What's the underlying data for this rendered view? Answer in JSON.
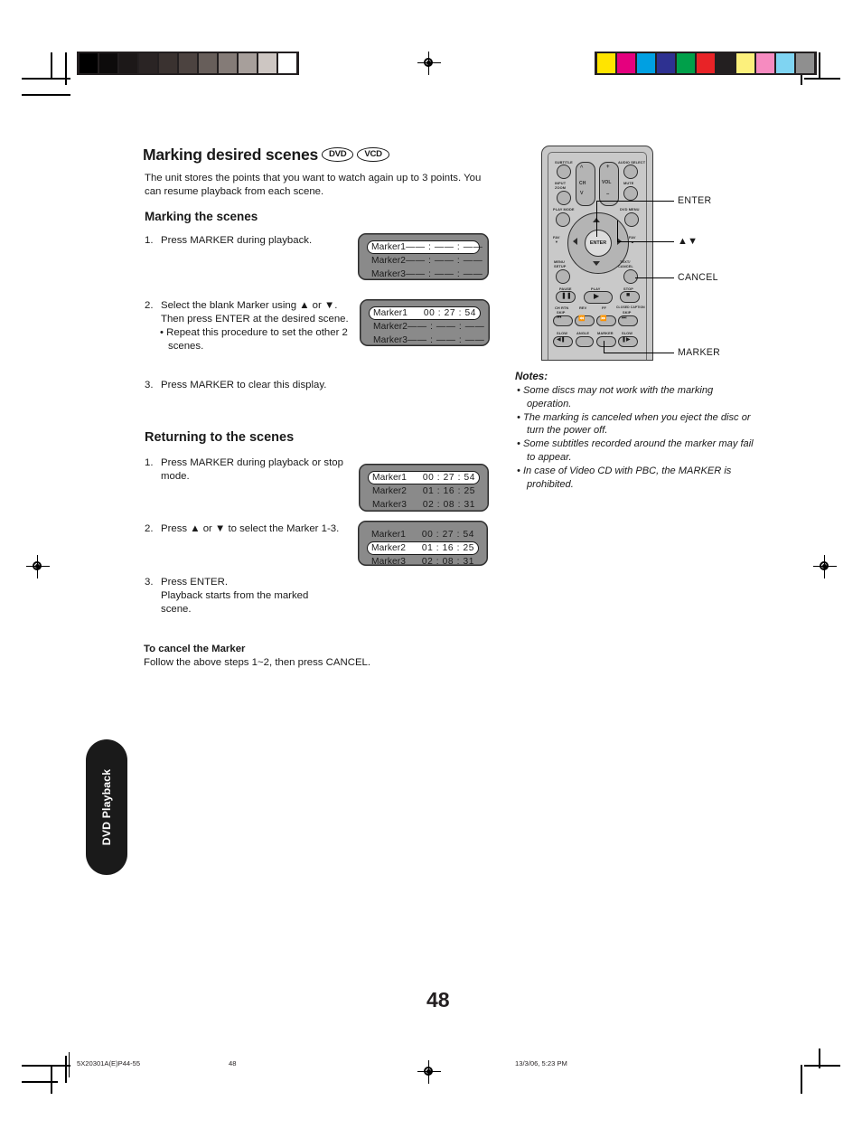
{
  "document": {
    "section_title": "Marking desired scenes",
    "media_badges": [
      "DVD",
      "VCD"
    ],
    "intro": "The unit stores the points that you want to watch again up to 3 points. You can resume playback from each scene.",
    "page_number": "48"
  },
  "marking": {
    "heading": "Marking the scenes",
    "steps": [
      {
        "num": "1.",
        "text": "Press MARKER during playback."
      },
      {
        "num": "2.",
        "text": "Select the blank Marker using ▲ or ▼. Then press ENTER at the desired scene.",
        "sub": "• Repeat this procedure to set the other 2 scenes."
      },
      {
        "num": "3.",
        "text": "Press MARKER to clear this display."
      }
    ]
  },
  "returning": {
    "heading": "Returning to the scenes",
    "steps": [
      {
        "num": "1.",
        "text": "Press MARKER during playback or stop mode."
      },
      {
        "num": "2.",
        "text": "Press ▲ or ▼ to select the Marker 1-3."
      },
      {
        "num": "3.",
        "text": "Press ENTER.",
        "extra": "Playback starts from the marked scene."
      }
    ]
  },
  "cancel": {
    "heading": "To cancel the Marker",
    "text": "Follow the above steps 1~2, then press CANCEL."
  },
  "osd_panels": [
    {
      "id": "osd-marking-step1",
      "rows": [
        {
          "label": "Marker1",
          "time": "—— : —— : ——",
          "selected": true
        },
        {
          "label": "Marker2",
          "time": "—— : —— : ——",
          "selected": false
        },
        {
          "label": "Marker3",
          "time": "—— : —— : ——",
          "selected": false
        }
      ]
    },
    {
      "id": "osd-marking-step2",
      "rows": [
        {
          "label": "Marker1",
          "time": "00 : 27 : 54",
          "selected": true
        },
        {
          "label": "Marker2",
          "time": "—— : —— : ——",
          "selected": false
        },
        {
          "label": "Marker3",
          "time": "—— : —— : ——",
          "selected": false
        }
      ]
    },
    {
      "id": "osd-returning-step1",
      "rows": [
        {
          "label": "Marker1",
          "time": "00 : 27 : 54",
          "selected": true
        },
        {
          "label": "Marker2",
          "time": "01 : 16 : 25",
          "selected": false
        },
        {
          "label": "Marker3",
          "time": "02 : 08 : 31",
          "selected": false
        }
      ]
    },
    {
      "id": "osd-returning-step2",
      "rows": [
        {
          "label": "Marker1",
          "time": "00 : 27 : 54",
          "selected": false
        },
        {
          "label": "Marker2",
          "time": "01 : 16 : 25",
          "selected": true
        },
        {
          "label": "Marker3",
          "time": "02 : 08 : 31",
          "selected": false
        }
      ]
    }
  ],
  "remote": {
    "buttons": [
      "SUBTITLE",
      "AUDIO SELECT",
      "INPUT ZOOM",
      "CH",
      "VOL",
      "MUTE",
      "PLAY MODE",
      "DVD MENU",
      "ENTER",
      "FAV ▼",
      "FAV ▲",
      "MENU SETUP",
      "TEXT/ CANCEL",
      "PAUSE",
      "PLAY",
      "STOP",
      "CH RTN SKIP",
      "REV",
      "FF",
      "CLOSED CAPTION SKIP",
      "SLOW",
      "ANGLE",
      "MARKER",
      "SLOW"
    ],
    "labels": {
      "subtitle": "SUBTITLE",
      "audio_select": "AUDIO SELECT",
      "input_zoom_1": "INPUT",
      "input_zoom_2": "ZOOM",
      "ch": "CH",
      "vol": "VOL",
      "mute": "MUTE",
      "play_mode": "PLAY MODE",
      "dvd_menu": "DVD MENU",
      "enter": "ENTER",
      "fav_down_1": "FAV",
      "fav_down_2": "▼",
      "fav_up_1": "FAV",
      "fav_up_2": "▲",
      "menu_1": "MENU",
      "menu_2": "SETUP",
      "text_1": "TEXT/",
      "text_2": "CANCEL",
      "pause": "PAUSE",
      "play": "PLAY",
      "stop": "STOP",
      "chrtn_1": "CH RTN",
      "chrtn_2": "SKIP",
      "rev": "REV",
      "ff": "FF",
      "cc_1": "CLOSED CAPTION",
      "cc_2": "SKIP",
      "slow_left": "SLOW",
      "angle": "ANGLE",
      "marker": "MARKER",
      "slow_right": "SLOW",
      "vol_plus": "+",
      "vol_minus": "–"
    },
    "callouts": [
      {
        "label": "ENTER"
      },
      {
        "label": "▲▼"
      },
      {
        "label": "CANCEL"
      },
      {
        "label": "MARKER"
      }
    ]
  },
  "notes": {
    "title": "Notes:",
    "items": [
      "• Some discs may not work with the marking operation.",
      "• The marking is canceled when you eject the disc or turn the power off.",
      "• Some subtitles recorded around the marker may fail to appear.",
      "• In case of Video CD with PBC, the MARKER is prohibited."
    ]
  },
  "side_tab": {
    "label": "DVD Playback"
  },
  "footer": {
    "left": "5X20301A(E)P44-55",
    "center": "48",
    "right": "13/3/06, 5:23 PM"
  },
  "color_bars": {
    "grayscale": [
      "#000000",
      "#0d0b0b",
      "#1c1818",
      "#2a2424",
      "#3a3230",
      "#4c4340",
      "#675e5a",
      "#847b77",
      "#a79f9b",
      "#cdc6c2",
      "#ffffff"
    ],
    "colors": [
      "#ffe400",
      "#e5007e",
      "#00a0e2",
      "#2e3191",
      "#00a04a",
      "#e82327",
      "#231f20",
      "#fcf07c",
      "#f68bc0",
      "#7fd4f2",
      "#8f8f8f"
    ]
  }
}
